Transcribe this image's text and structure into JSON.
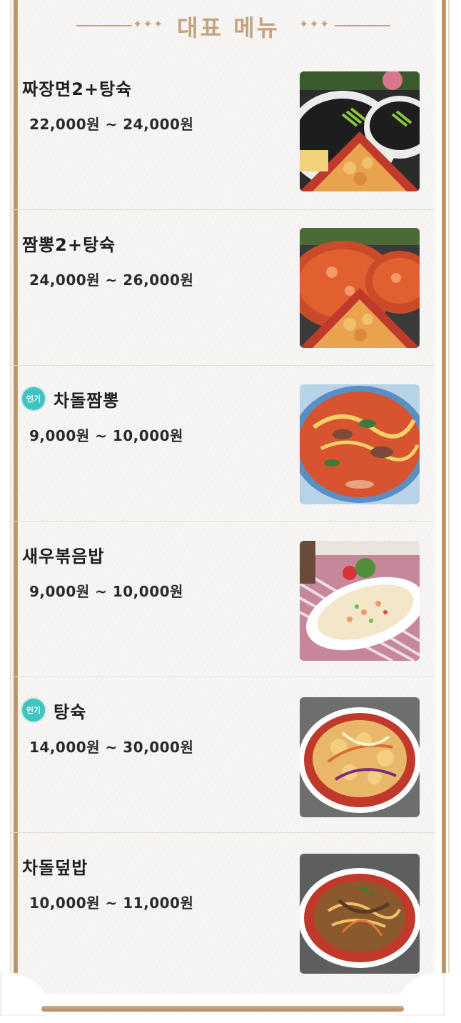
{
  "header": {
    "title": "대표 메뉴",
    "decoration_left": "✦✦✦",
    "decoration_right": "✦✦✦"
  },
  "menu": [
    {
      "name": "짜장면2+탕슉",
      "price": "22,000원 ~ 24,000원",
      "badge": "",
      "image_icon": "jajangmyeon-tangsuyuk-photo"
    },
    {
      "name": "짬뽕2+탕슉",
      "price": "24,000원 ~ 26,000원",
      "badge": "",
      "image_icon": "jjamppong-tangsuyuk-photo"
    },
    {
      "name": "차돌짬뽕",
      "price": "9,000원 ~ 10,000원",
      "badge": "인기",
      "image_icon": "chadol-jjamppong-photo"
    },
    {
      "name": "새우볶음밥",
      "price": "9,000원 ~ 10,000원",
      "badge": "",
      "image_icon": "shrimp-fried-rice-photo"
    },
    {
      "name": "탕슉",
      "price": "14,000원 ~ 30,000원",
      "badge": "인기",
      "image_icon": "tangsuyuk-photo"
    },
    {
      "name": "차돌덮밥",
      "price": "10,000원 ~ 11,000원",
      "badge": "",
      "image_icon": "chadol-deopbap-photo"
    }
  ],
  "colors": {
    "accent": "#c6a37f",
    "badge": "#3fc4c0",
    "frame": "#b98e62",
    "text": "#1f1f1f"
  }
}
